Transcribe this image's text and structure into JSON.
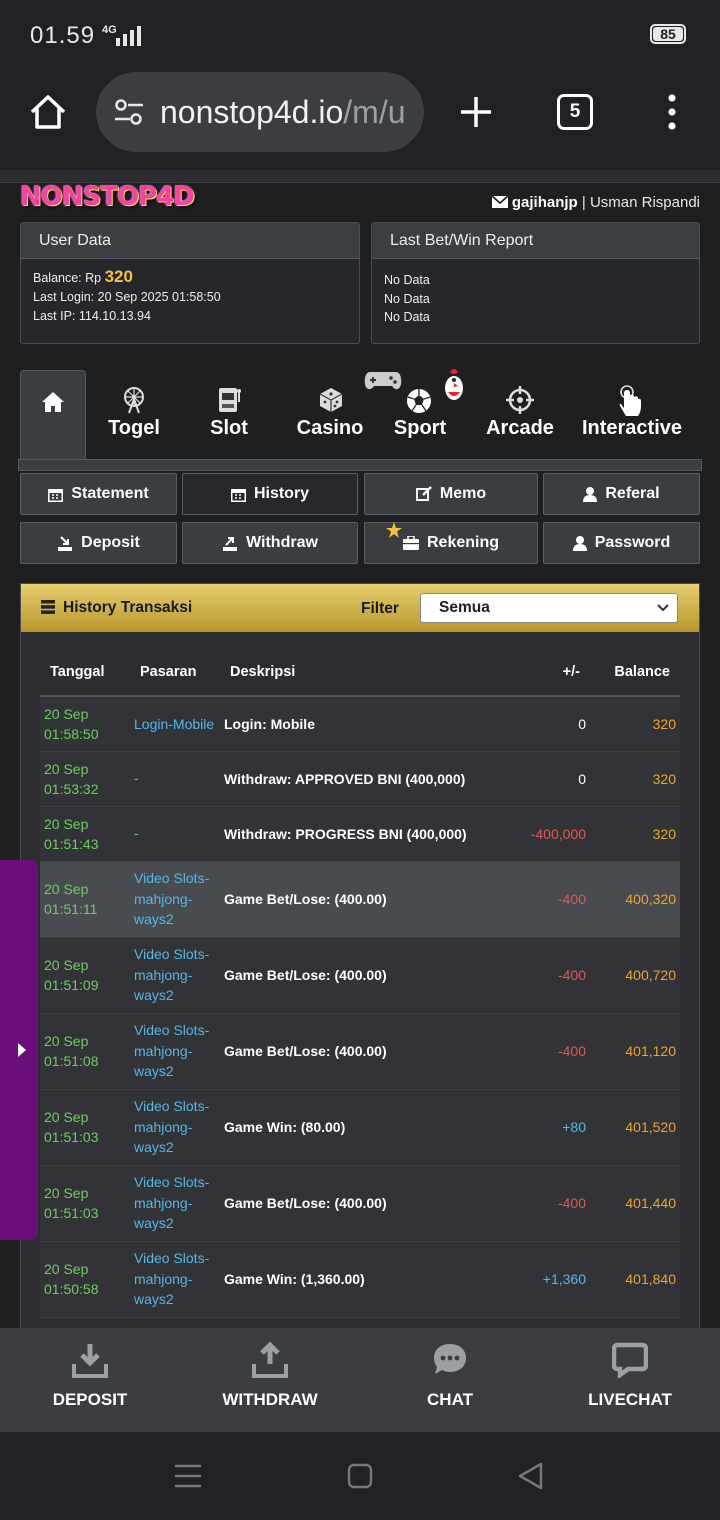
{
  "status": {
    "time": "01.59",
    "network": "4G",
    "battery": "85"
  },
  "browser": {
    "url_main": "nonstop4d.io",
    "url_rest": "/m/u",
    "tab_count": "5"
  },
  "site": {
    "logo": "NONSTOP4D",
    "username": "gajihanjp",
    "separator": "|",
    "fullname": "Usman Rispandi",
    "user_data": {
      "title": "User Data",
      "balance_label": "Balance: Rp",
      "balance_value": "320",
      "last_login": "Last Login: 20 Sep 2025 01:58:50",
      "last_ip": "Last IP: 114.10.13.94"
    },
    "report": {
      "title": "Last Bet/Win Report",
      "lines": [
        "No Data",
        "No Data",
        "No Data"
      ]
    },
    "nav": [
      "Togel",
      "Slot",
      "Casino",
      "Sport",
      "Arcade",
      "Interactive"
    ],
    "buttons": [
      "Statement",
      "History",
      "Memo",
      "Referal",
      "Deposit",
      "Withdraw",
      "Rekening",
      "Password"
    ],
    "history": {
      "title": "History Transaksi",
      "filter_label": "Filter",
      "filter_value": "Semua",
      "columns": [
        "Tanggal",
        "Pasaran",
        "Deskripsi",
        "+/-",
        "Balance"
      ],
      "rows": [
        {
          "date": "20 Sep",
          "time": "01:58:50",
          "pasaran": "Login-Mobile",
          "desc": "Login: Mobile",
          "pm": "0",
          "balance": "320"
        },
        {
          "date": "20 Sep",
          "time": "01:53:32",
          "pasaran": "-",
          "desc": "Withdraw: APPROVED BNI (400,000)",
          "pm": "0",
          "balance": "320"
        },
        {
          "date": "20 Sep",
          "time": "01:51:43",
          "pasaran": "-",
          "desc": "Withdraw: PROGRESS BNI (400,000)",
          "pm": "-400,000",
          "balance": "320"
        },
        {
          "date": "20 Sep",
          "time": "01:51:11",
          "pasaran": "Video Slots-mahjong-ways2",
          "desc": "Game Bet/Lose: (400.00)",
          "pm": "-400",
          "balance": "400,320"
        },
        {
          "date": "20 Sep",
          "time": "01:51:09",
          "pasaran": "Video Slots-mahjong-ways2",
          "desc": "Game Bet/Lose: (400.00)",
          "pm": "-400",
          "balance": "400,720"
        },
        {
          "date": "20 Sep",
          "time": "01:51:08",
          "pasaran": "Video Slots-mahjong-ways2",
          "desc": "Game Bet/Lose: (400.00)",
          "pm": "-400",
          "balance": "401,120"
        },
        {
          "date": "20 Sep",
          "time": "01:51:03",
          "pasaran": "Video Slots-mahjong-ways2",
          "desc": "Game Win: (80.00)",
          "pm": "+80",
          "balance": "401,520"
        },
        {
          "date": "20 Sep",
          "time": "01:51:03",
          "pasaran": "Video Slots-mahjong-ways2",
          "desc": "Game Bet/Lose: (400.00)",
          "pm": "-400",
          "balance": "401,440"
        },
        {
          "date": "20 Sep",
          "time": "01:50:58",
          "pasaran": "Video Slots-mahjong-ways2",
          "desc": "Game Win: (1,360.00)",
          "pm": "+1,360",
          "balance": "401,840"
        }
      ]
    }
  },
  "bottom_nav": [
    "DEPOSIT",
    "WITHDRAW",
    "CHAT",
    "LIVECHAT"
  ],
  "colors": {
    "bg": "#1d1f21",
    "gold": "#f3c13a",
    "date_green": "#6ccf5e",
    "link_blue": "#56b7e6",
    "negative": "#e25757",
    "balance_orange": "#f0a52a",
    "side_purple": "#6a0f7c"
  }
}
